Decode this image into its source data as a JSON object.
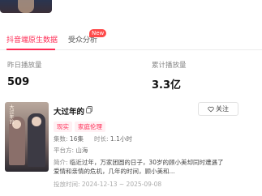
{
  "tabs": [
    {
      "label": "抖音端原生数据"
    },
    {
      "label": "受众分析",
      "badge": "New"
    }
  ],
  "stats": {
    "today_label": "昨日播放量",
    "today_value": "509",
    "total_label": "累计播放量",
    "total_value": "3.3亿"
  },
  "drama": {
    "title": "大过年的",
    "poster_text": "大过年的",
    "follow_label": "关注",
    "tags": [
      "现实",
      "家庭伦理"
    ],
    "episodes_label": "集数:",
    "episodes_value": "16集",
    "duration_label": "时长:",
    "duration_value": "1.1小时",
    "platform_label": "平台方:",
    "platform_value": "山海",
    "intro_label": "简介:",
    "intro_text": "临近过年，万家团圆的日子，30岁的顾小美却同时遭遇了爱情和亲情的危机，几年的时间，顾小美和...",
    "date_label": "投放时间:",
    "date_value": "2024-12-13 ~ 2025-09-08"
  },
  "colors": {
    "accent": "#fe2c55",
    "badge": "#fe4a4a"
  },
  "icons": [
    "copy-icon",
    "heart-icon"
  ]
}
